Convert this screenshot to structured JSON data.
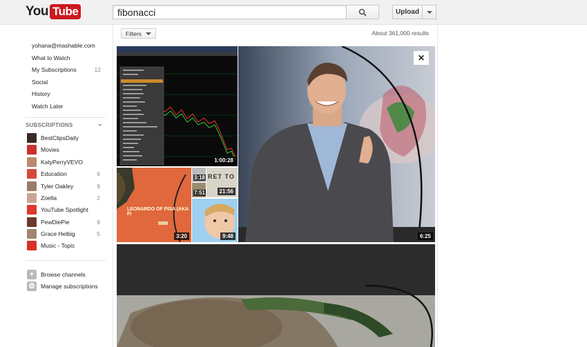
{
  "header": {
    "logo_you": "You",
    "logo_tube": "Tube",
    "search_value": "fibonacci",
    "upload_label": "Upload"
  },
  "guide": {
    "items": [
      {
        "label": "yohana@mashable.com",
        "count": ""
      },
      {
        "label": "What to Watch",
        "count": ""
      },
      {
        "label": "My Subscriptions",
        "count": "12"
      },
      {
        "label": "Social",
        "count": ""
      },
      {
        "label": "History",
        "count": ""
      },
      {
        "label": "Watch Later",
        "count": ""
      }
    ],
    "subscriptions_header": "SUBSCRIPTIONS",
    "subscriptions": [
      {
        "name": "BestClipsDaily",
        "count": "",
        "color": "#3a2a22"
      },
      {
        "name": "Movies",
        "count": "",
        "color": "#c8302c"
      },
      {
        "name": "KatyPerryVEVO",
        "count": "",
        "color": "#b98a70"
      },
      {
        "name": "Education",
        "count": "6",
        "color": "#d24a3c"
      },
      {
        "name": "Tyler Oakley",
        "count": "9",
        "color": "#9a7c6a"
      },
      {
        "name": "Zoella",
        "count": "2",
        "color": "#c9a493"
      },
      {
        "name": "YouTube Spotlight",
        "count": "",
        "color": "#d93a2e"
      },
      {
        "name": "PewDiePie",
        "count": "9",
        "color": "#6b3a2a"
      },
      {
        "name": "Grace Helbig",
        "count": "5",
        "color": "#a38470"
      },
      {
        "name": "Music - Topic",
        "count": "",
        "color": "#d6322a"
      }
    ],
    "footer": [
      {
        "label": "Browse channels",
        "icon": "plus-icon"
      },
      {
        "label": "Manage subscriptions",
        "icon": "gear-icon"
      }
    ]
  },
  "main": {
    "filters_label": "Filters",
    "results_count": "About 361,000 results",
    "videos": [
      {
        "duration": "1:00:28"
      },
      {
        "duration": "3:20"
      },
      {
        "duration": "3:18"
      },
      {
        "duration": "7:51"
      },
      {
        "duration": "21:56"
      },
      {
        "duration": "9:48"
      },
      {
        "duration": "6:25"
      }
    ],
    "thumb_text": {
      "leonardo": "LEONARDO OF PISA (AKA FI",
      "ret": "RET TO"
    },
    "close_glyph": "✕"
  },
  "colors": {
    "accent_red": "#cc181e",
    "header_bg": "#f1f1f1"
  }
}
